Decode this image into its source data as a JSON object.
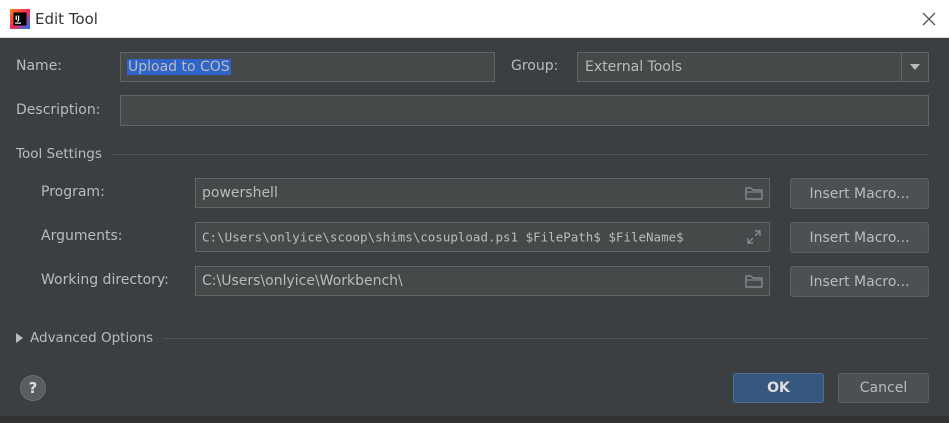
{
  "window": {
    "title": "Edit Tool",
    "app_icon": "intellij-idea-icon",
    "close_icon": "close-icon"
  },
  "form": {
    "name_label": "Name:",
    "name_value": "Upload to COS",
    "group_label": "Group:",
    "group_value": "External Tools",
    "description_label": "Description:",
    "description_value": ""
  },
  "tool_settings": {
    "section_label": "Tool Settings",
    "program_label": "Program:",
    "program_value": "powershell",
    "arguments_label": "Arguments:",
    "arguments_value": "C:\\Users\\onlyice\\scoop\\shims\\cosupload.ps1 $FilePath$ $FileName$",
    "working_dir_label": "Working directory:",
    "working_dir_value": "C:\\Users\\onlyice\\Workbench\\",
    "insert_macro_label": "Insert Macro..."
  },
  "advanced": {
    "label": "Advanced Options",
    "expanded": false
  },
  "footer": {
    "help_label": "?",
    "ok_label": "OK",
    "cancel_label": "Cancel"
  },
  "colors": {
    "background": "#3c3f41",
    "field_bg": "#45494a",
    "selection": "#2f65ca",
    "primary_button": "#365880"
  }
}
